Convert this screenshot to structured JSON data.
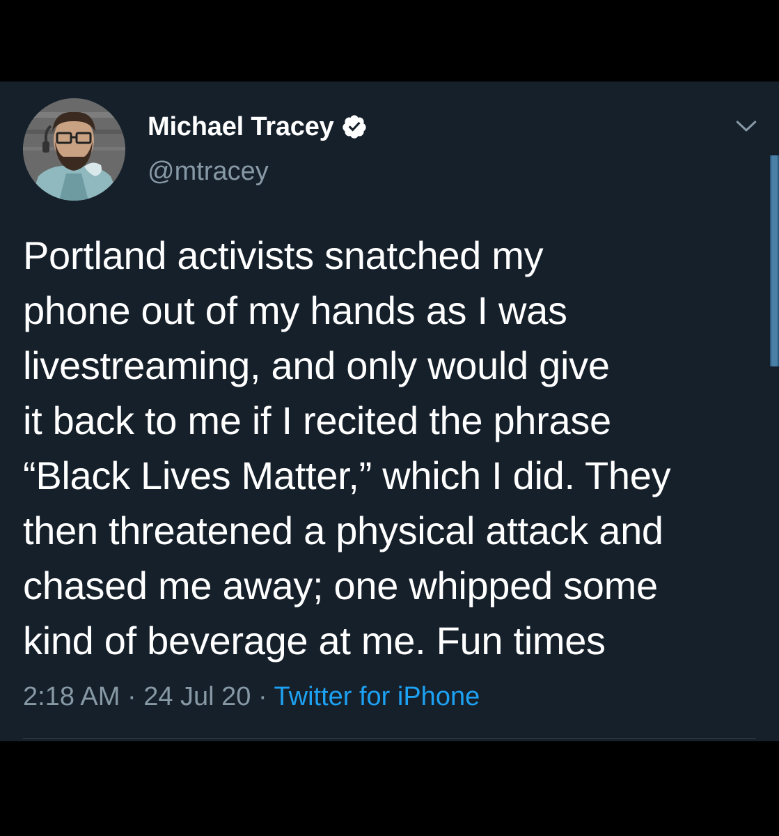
{
  "tweet": {
    "author_name": "Michael Tracey",
    "handle": "@mtracey",
    "verified": true,
    "text_lines": [
      "Portland activists snatched my",
      "phone out of my hands as I was",
      "livestreaming, and only would give",
      "it back to me if I recited the phrase",
      "“Black Lives Matter,” which I did. They",
      "then threatened a physical attack and",
      "chased me away; one whipped some",
      "kind of beverage at me. Fun times"
    ],
    "time": "2:18 AM",
    "separator": "·",
    "date": "24 Jul 20",
    "source": "Twitter for iPhone"
  },
  "icons": {
    "verified": "verified-badge-icon",
    "menu": "chevron-down-icon"
  },
  "colors": {
    "background": "#15202b",
    "outer": "#000000",
    "text": "#ffffff",
    "secondary": "#8899a6",
    "link": "#1da1f2",
    "divider": "#38444d"
  }
}
